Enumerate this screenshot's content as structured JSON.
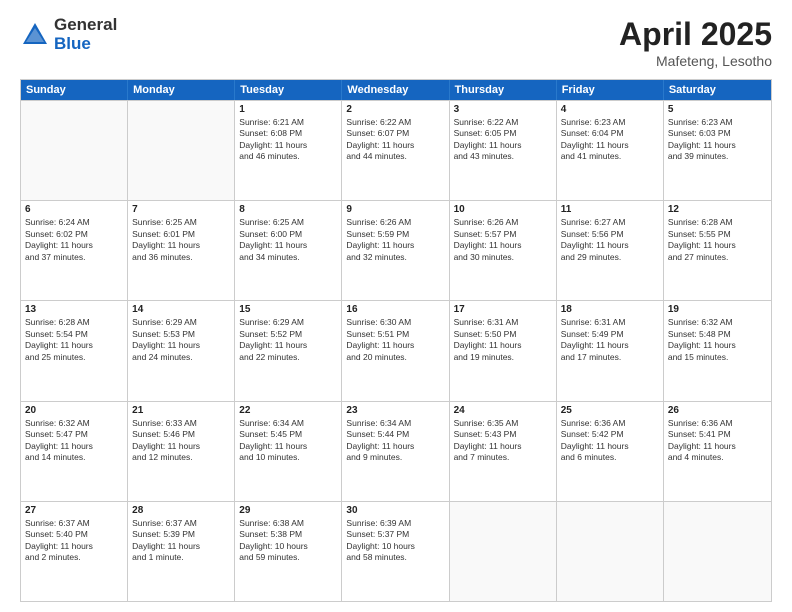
{
  "logo": {
    "general": "General",
    "blue": "Blue"
  },
  "title": {
    "month_year": "April 2025",
    "location": "Mafeteng, Lesotho"
  },
  "calendar": {
    "headers": [
      "Sunday",
      "Monday",
      "Tuesday",
      "Wednesday",
      "Thursday",
      "Friday",
      "Saturday"
    ],
    "rows": [
      [
        {
          "day": "",
          "lines": [],
          "empty": true
        },
        {
          "day": "",
          "lines": [],
          "empty": true
        },
        {
          "day": "1",
          "lines": [
            "Sunrise: 6:21 AM",
            "Sunset: 6:08 PM",
            "Daylight: 11 hours",
            "and 46 minutes."
          ]
        },
        {
          "day": "2",
          "lines": [
            "Sunrise: 6:22 AM",
            "Sunset: 6:07 PM",
            "Daylight: 11 hours",
            "and 44 minutes."
          ]
        },
        {
          "day": "3",
          "lines": [
            "Sunrise: 6:22 AM",
            "Sunset: 6:05 PM",
            "Daylight: 11 hours",
            "and 43 minutes."
          ]
        },
        {
          "day": "4",
          "lines": [
            "Sunrise: 6:23 AM",
            "Sunset: 6:04 PM",
            "Daylight: 11 hours",
            "and 41 minutes."
          ]
        },
        {
          "day": "5",
          "lines": [
            "Sunrise: 6:23 AM",
            "Sunset: 6:03 PM",
            "Daylight: 11 hours",
            "and 39 minutes."
          ]
        }
      ],
      [
        {
          "day": "6",
          "lines": [
            "Sunrise: 6:24 AM",
            "Sunset: 6:02 PM",
            "Daylight: 11 hours",
            "and 37 minutes."
          ]
        },
        {
          "day": "7",
          "lines": [
            "Sunrise: 6:25 AM",
            "Sunset: 6:01 PM",
            "Daylight: 11 hours",
            "and 36 minutes."
          ]
        },
        {
          "day": "8",
          "lines": [
            "Sunrise: 6:25 AM",
            "Sunset: 6:00 PM",
            "Daylight: 11 hours",
            "and 34 minutes."
          ]
        },
        {
          "day": "9",
          "lines": [
            "Sunrise: 6:26 AM",
            "Sunset: 5:59 PM",
            "Daylight: 11 hours",
            "and 32 minutes."
          ]
        },
        {
          "day": "10",
          "lines": [
            "Sunrise: 6:26 AM",
            "Sunset: 5:57 PM",
            "Daylight: 11 hours",
            "and 30 minutes."
          ]
        },
        {
          "day": "11",
          "lines": [
            "Sunrise: 6:27 AM",
            "Sunset: 5:56 PM",
            "Daylight: 11 hours",
            "and 29 minutes."
          ]
        },
        {
          "day": "12",
          "lines": [
            "Sunrise: 6:28 AM",
            "Sunset: 5:55 PM",
            "Daylight: 11 hours",
            "and 27 minutes."
          ]
        }
      ],
      [
        {
          "day": "13",
          "lines": [
            "Sunrise: 6:28 AM",
            "Sunset: 5:54 PM",
            "Daylight: 11 hours",
            "and 25 minutes."
          ]
        },
        {
          "day": "14",
          "lines": [
            "Sunrise: 6:29 AM",
            "Sunset: 5:53 PM",
            "Daylight: 11 hours",
            "and 24 minutes."
          ]
        },
        {
          "day": "15",
          "lines": [
            "Sunrise: 6:29 AM",
            "Sunset: 5:52 PM",
            "Daylight: 11 hours",
            "and 22 minutes."
          ]
        },
        {
          "day": "16",
          "lines": [
            "Sunrise: 6:30 AM",
            "Sunset: 5:51 PM",
            "Daylight: 11 hours",
            "and 20 minutes."
          ]
        },
        {
          "day": "17",
          "lines": [
            "Sunrise: 6:31 AM",
            "Sunset: 5:50 PM",
            "Daylight: 11 hours",
            "and 19 minutes."
          ]
        },
        {
          "day": "18",
          "lines": [
            "Sunrise: 6:31 AM",
            "Sunset: 5:49 PM",
            "Daylight: 11 hours",
            "and 17 minutes."
          ]
        },
        {
          "day": "19",
          "lines": [
            "Sunrise: 6:32 AM",
            "Sunset: 5:48 PM",
            "Daylight: 11 hours",
            "and 15 minutes."
          ]
        }
      ],
      [
        {
          "day": "20",
          "lines": [
            "Sunrise: 6:32 AM",
            "Sunset: 5:47 PM",
            "Daylight: 11 hours",
            "and 14 minutes."
          ]
        },
        {
          "day": "21",
          "lines": [
            "Sunrise: 6:33 AM",
            "Sunset: 5:46 PM",
            "Daylight: 11 hours",
            "and 12 minutes."
          ]
        },
        {
          "day": "22",
          "lines": [
            "Sunrise: 6:34 AM",
            "Sunset: 5:45 PM",
            "Daylight: 11 hours",
            "and 10 minutes."
          ]
        },
        {
          "day": "23",
          "lines": [
            "Sunrise: 6:34 AM",
            "Sunset: 5:44 PM",
            "Daylight: 11 hours",
            "and 9 minutes."
          ]
        },
        {
          "day": "24",
          "lines": [
            "Sunrise: 6:35 AM",
            "Sunset: 5:43 PM",
            "Daylight: 11 hours",
            "and 7 minutes."
          ]
        },
        {
          "day": "25",
          "lines": [
            "Sunrise: 6:36 AM",
            "Sunset: 5:42 PM",
            "Daylight: 11 hours",
            "and 6 minutes."
          ]
        },
        {
          "day": "26",
          "lines": [
            "Sunrise: 6:36 AM",
            "Sunset: 5:41 PM",
            "Daylight: 11 hours",
            "and 4 minutes."
          ]
        }
      ],
      [
        {
          "day": "27",
          "lines": [
            "Sunrise: 6:37 AM",
            "Sunset: 5:40 PM",
            "Daylight: 11 hours",
            "and 2 minutes."
          ]
        },
        {
          "day": "28",
          "lines": [
            "Sunrise: 6:37 AM",
            "Sunset: 5:39 PM",
            "Daylight: 11 hours",
            "and 1 minute."
          ]
        },
        {
          "day": "29",
          "lines": [
            "Sunrise: 6:38 AM",
            "Sunset: 5:38 PM",
            "Daylight: 10 hours",
            "and 59 minutes."
          ]
        },
        {
          "day": "30",
          "lines": [
            "Sunrise: 6:39 AM",
            "Sunset: 5:37 PM",
            "Daylight: 10 hours",
            "and 58 minutes."
          ]
        },
        {
          "day": "",
          "lines": [],
          "empty": true
        },
        {
          "day": "",
          "lines": [],
          "empty": true
        },
        {
          "day": "",
          "lines": [],
          "empty": true
        }
      ]
    ]
  }
}
